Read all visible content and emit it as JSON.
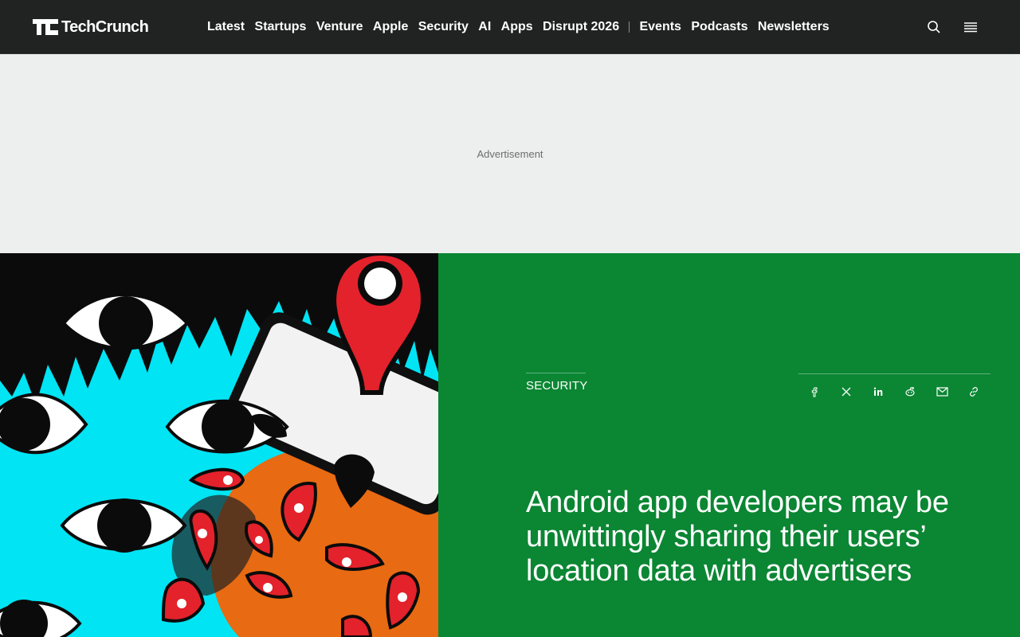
{
  "header": {
    "logo_text": "TechCrunch",
    "nav": [
      "Latest",
      "Startups",
      "Venture",
      "Apple",
      "Security",
      "AI",
      "Apps",
      "Disrupt 2026"
    ],
    "nav_secondary": [
      "Events",
      "Podcasts",
      "Newsletters"
    ],
    "icons": {
      "search": "search-icon",
      "menu": "hamburger-menu-icon"
    }
  },
  "ad": {
    "label": "Advertisement"
  },
  "article": {
    "category": "SECURITY",
    "headline": "Android app developers may be unwittingly sharing their users’ location data with advertisers",
    "share_icons": [
      "facebook-icon",
      "x-icon",
      "linkedin-icon",
      "reddit-icon",
      "email-icon",
      "link-icon"
    ]
  },
  "colors": {
    "header_bg": "#202322",
    "ad_bg": "#ecefee",
    "hero_panel_bg": "#0b8633",
    "hero_image_cyan": "#00e4f4",
    "hero_image_red": "#e3222b",
    "hero_image_orange": "#e86a12"
  }
}
